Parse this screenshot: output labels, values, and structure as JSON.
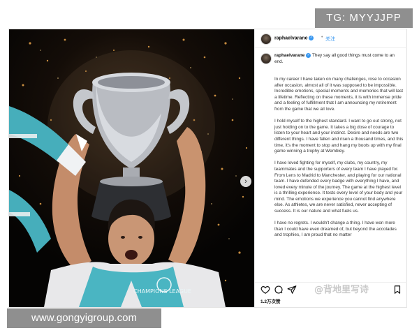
{
  "corner_tag": "TG: MYYJJPP",
  "footer_url": "www.gongyigroup.com",
  "watermark": "@背地里写诗",
  "post": {
    "photo": {
      "icons": [
        "trophy",
        "scarf",
        "fireworks"
      ],
      "carousel_arrow": "›",
      "scarf_text": "CHAMPIONS LEAGUE"
    },
    "header": {
      "username": "raphaelvarane",
      "verified_glyph": "✓",
      "separator": "•",
      "follow": "关注"
    },
    "caption": {
      "username": "raphaelvarane",
      "intro": "They say all good things must come to an end.",
      "paragraphs": [
        "In my career I have taken on many challenges, rose to occasion after occasion, almost all of it was supposed to be impossible. Incredible emotions, special moments and memories that will last a lifetime. Reflecting on these moments, it is with immense pride and a feeling of fulfillment that I am announcing my retirement from the game that we all love.",
        "I hold myself to the highest standard. I want to go out strong, not just holding on to the game. It takes a big dose of courage to listen to your heart and your instinct. Desire and needs are two different things. I have fallen and risen a thousand times, and this time, it's the moment to stop and hang my boots up with my final game winning a trophy at Wembley.",
        "I have loved fighting for myself, my clubs, my country, my teammates and the supporters of every team I have played for. From Lens to Madrid to Manchester, and playing for our national team. I have defended every badge with everything I have, and loved every minute of the journey. The game at the highest level is a thrilling experience. It tests every level of your body and your mind. The emotions we experience you cannot find anywhere else. As athletes, we are never satisfied, never accepting of success. It is our nature and what fuels us.",
        "I have no regrets. I wouldn't change a thing. I have won more than I could have even dreamed of, but beyond the accolades and trophies, I am proud that no matter"
      ]
    },
    "actions": {
      "icons": [
        "heart-icon",
        "comment-icon",
        "share-icon",
        "bookmark-icon"
      ]
    },
    "likes": "1.2万次赞"
  }
}
